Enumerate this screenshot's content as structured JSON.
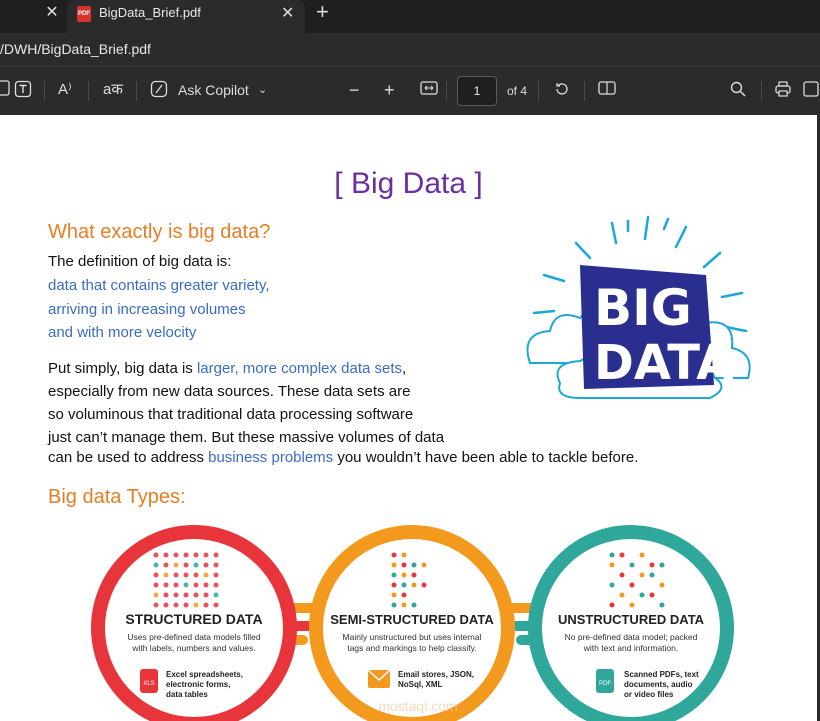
{
  "tabs": {
    "active_title": "BigData_Brief.pdf",
    "pdf_badge": "PDF"
  },
  "address": {
    "url": "/DWH/BigData_Brief.pdf"
  },
  "toolbar": {
    "copilot_label": "Ask Copilot",
    "page_number": "1",
    "page_total": "of 4",
    "translate_glyph": "aक",
    "read_aloud_glyph": "A⁾"
  },
  "doc": {
    "title": "[ Big Data ]",
    "section1_heading": "What exactly is big data?",
    "definition_intro": "The definition of big data is:",
    "definition_lines": [
      "data that contains greater variety,",
      "arriving in increasing volumes",
      "and with more velocity"
    ],
    "para_1": "Put simply, big data is ",
    "para_link1": "larger, more complex data sets",
    "para_2": ",",
    "para_line2": "especially from new data sources. These data sets are",
    "para_line3": "so voluminous that traditional data processing software",
    "para_line4": "just can’t manage them. But these massive volumes of data",
    "para_line5a": "can be used to address ",
    "para_link2": "business problems",
    "para_line5b": " you wouldn’t have been able to tackle before.",
    "section2_heading": "Big data Types:",
    "art_big": "BIG",
    "art_data": "DATA",
    "types": [
      {
        "title": "STRUCTURED DATA",
        "desc_line1": "Uses pre-defined data models filled",
        "desc_line2": "with labels, numbers and values.",
        "badge": "XLS",
        "ex_line1": "Excel spreadsheets,",
        "ex_line2": "electronic forms,",
        "ex_line3": "data tables",
        "color": "#e8343b"
      },
      {
        "title": "SEMI-STRUCTURED DATA",
        "desc_line1": "Mainly unstructured but uses internal",
        "desc_line2": "tags and markings to help classify.",
        "badge": "",
        "ex_line1": "Email stores, JSON,",
        "ex_line2": "NoSql, XML",
        "ex_line3": "",
        "color": "#f39a1e"
      },
      {
        "title": "UNSTRUCTURED DATA",
        "desc_line1": "No pre-defined data model; packed",
        "desc_line2": "with text and information.",
        "badge": "PDF",
        "ex_line1": "Scanned PDFs, text",
        "ex_line2": "documents, audio",
        "ex_line3": "or video files",
        "color": "#2fa89b"
      }
    ],
    "watermark": "mostaql.com"
  },
  "colors": {
    "title_purple": "#6a2fa0",
    "heading_orange": "#e67e22",
    "link_blue": "#3b6cc4",
    "art_navy": "#2a2f8f",
    "art_cyan": "#1aa7d9"
  }
}
